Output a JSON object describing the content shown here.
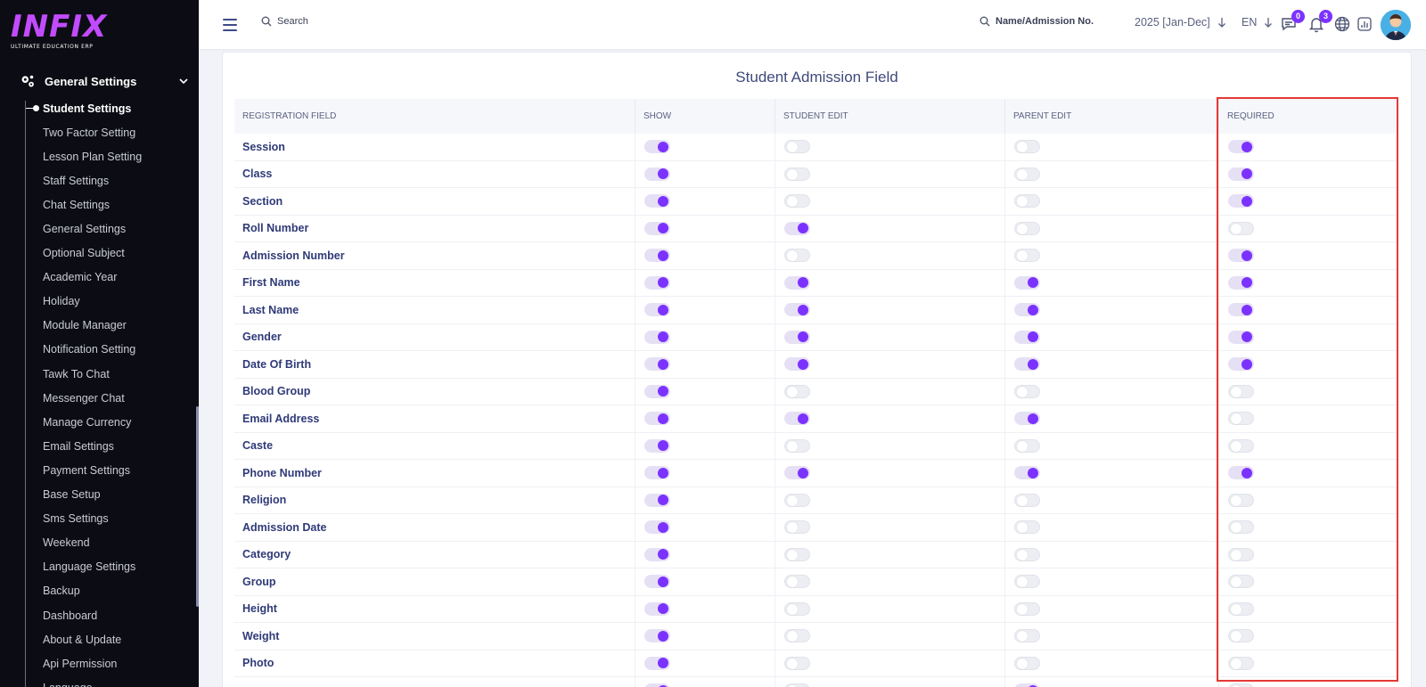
{
  "brand": {
    "logo_text": "INFIX",
    "tagline": "ULTIMATE EDUCATION ERP",
    "accent": "#7c32ff"
  },
  "sidebar": {
    "group_label": "General Settings",
    "items": [
      {
        "label": "Student Settings",
        "active": true
      },
      {
        "label": "Two Factor Setting"
      },
      {
        "label": "Lesson Plan Setting"
      },
      {
        "label": "Staff Settings"
      },
      {
        "label": "Chat Settings"
      },
      {
        "label": "General Settings"
      },
      {
        "label": "Optional Subject"
      },
      {
        "label": "Academic Year"
      },
      {
        "label": "Holiday"
      },
      {
        "label": "Module Manager"
      },
      {
        "label": "Notification Setting"
      },
      {
        "label": "Tawk To Chat"
      },
      {
        "label": "Messenger Chat"
      },
      {
        "label": "Manage Currency"
      },
      {
        "label": "Email Settings"
      },
      {
        "label": "Payment Settings"
      },
      {
        "label": "Base Setup"
      },
      {
        "label": "Sms Settings"
      },
      {
        "label": "Weekend"
      },
      {
        "label": "Language Settings"
      },
      {
        "label": "Backup"
      },
      {
        "label": "Dashboard"
      },
      {
        "label": "About & Update"
      },
      {
        "label": "Api Permission"
      },
      {
        "label": "Language"
      }
    ]
  },
  "topbar": {
    "search_label": "Search",
    "admission_search_label": "Name/Admission No.",
    "year_label": "2025 [Jan-Dec]",
    "language_label": "EN",
    "chat_badge": "0",
    "notification_badge": "3"
  },
  "page": {
    "title": "Student Admission Field",
    "columns": [
      "REGISTRATION FIELD",
      "SHOW",
      "STUDENT EDIT",
      "PARENT EDIT",
      "REQUIRED"
    ],
    "rows": [
      {
        "field": "Session",
        "show": true,
        "student_edit": false,
        "parent_edit": false,
        "required": true
      },
      {
        "field": "Class",
        "show": true,
        "student_edit": false,
        "parent_edit": false,
        "required": true
      },
      {
        "field": "Section",
        "show": true,
        "student_edit": false,
        "parent_edit": false,
        "required": true
      },
      {
        "field": "Roll Number",
        "show": true,
        "student_edit": true,
        "parent_edit": false,
        "required": false
      },
      {
        "field": "Admission Number",
        "show": true,
        "student_edit": false,
        "parent_edit": false,
        "required": true
      },
      {
        "field": "First Name",
        "show": true,
        "student_edit": true,
        "parent_edit": true,
        "required": true
      },
      {
        "field": "Last Name",
        "show": true,
        "student_edit": true,
        "parent_edit": true,
        "required": true
      },
      {
        "field": "Gender",
        "show": true,
        "student_edit": true,
        "parent_edit": true,
        "required": true
      },
      {
        "field": "Date Of Birth",
        "show": true,
        "student_edit": true,
        "parent_edit": true,
        "required": true
      },
      {
        "field": "Blood Group",
        "show": true,
        "student_edit": false,
        "parent_edit": false,
        "required": false
      },
      {
        "field": "Email Address",
        "show": true,
        "student_edit": true,
        "parent_edit": true,
        "required": false
      },
      {
        "field": "Caste",
        "show": true,
        "student_edit": false,
        "parent_edit": false,
        "required": false
      },
      {
        "field": "Phone Number",
        "show": true,
        "student_edit": true,
        "parent_edit": true,
        "required": true
      },
      {
        "field": "Religion",
        "show": true,
        "student_edit": false,
        "parent_edit": false,
        "required": false
      },
      {
        "field": "Admission Date",
        "show": true,
        "student_edit": false,
        "parent_edit": false,
        "required": false
      },
      {
        "field": "Category",
        "show": true,
        "student_edit": false,
        "parent_edit": false,
        "required": false
      },
      {
        "field": "Group",
        "show": true,
        "student_edit": false,
        "parent_edit": false,
        "required": false
      },
      {
        "field": "Height",
        "show": true,
        "student_edit": false,
        "parent_edit": false,
        "required": false
      },
      {
        "field": "Weight",
        "show": true,
        "student_edit": false,
        "parent_edit": false,
        "required": false
      },
      {
        "field": "Photo",
        "show": true,
        "student_edit": false,
        "parent_edit": false,
        "required": false
      },
      {
        "field": "",
        "show": true,
        "student_edit": false,
        "parent_edit": true,
        "required": false
      }
    ]
  }
}
